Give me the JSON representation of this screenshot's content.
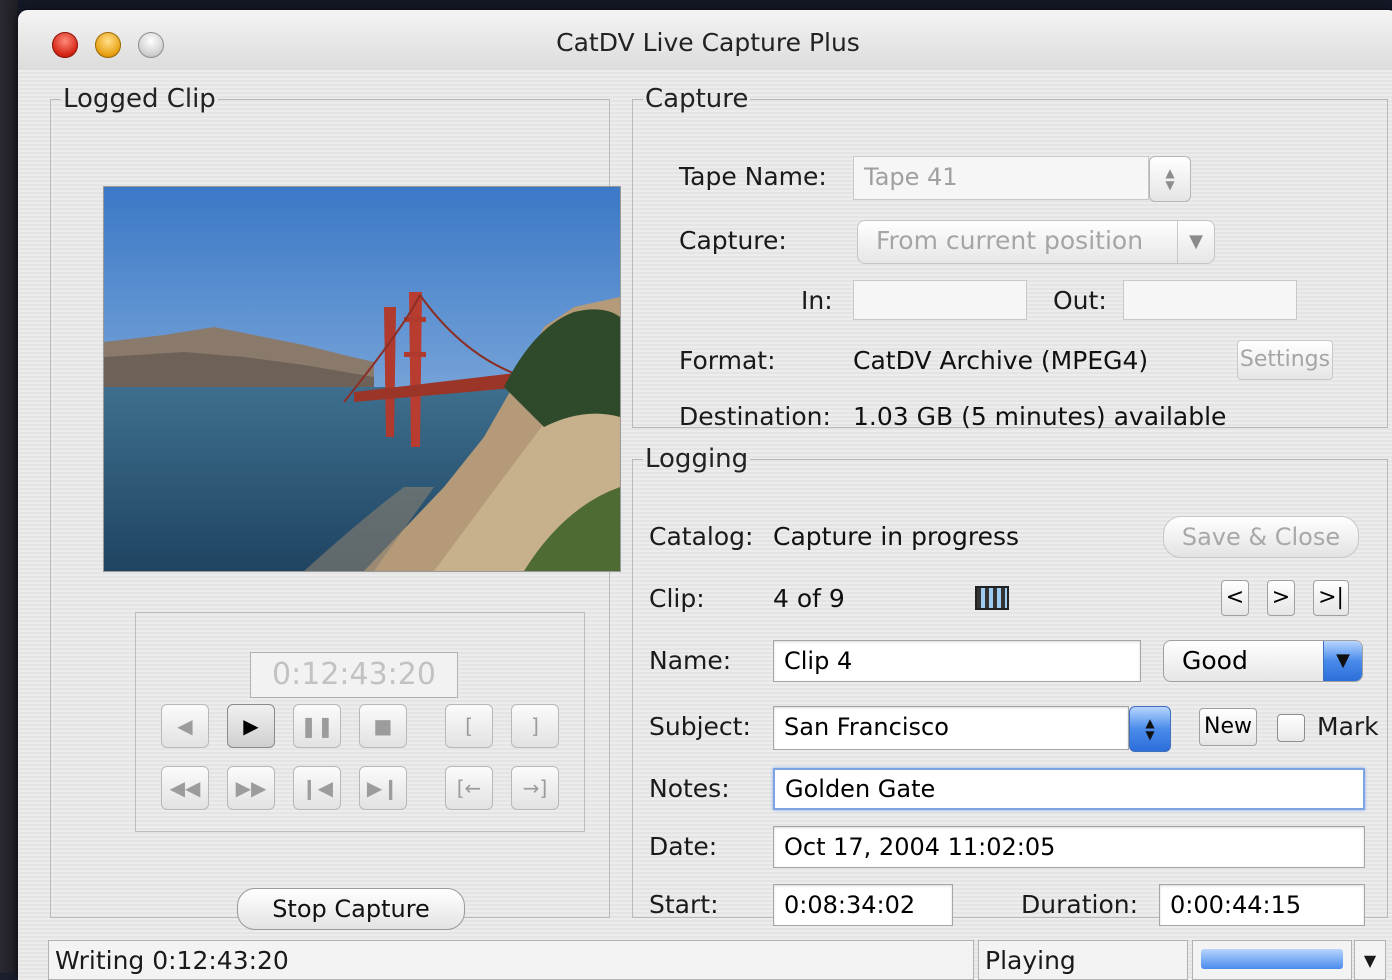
{
  "window": {
    "title": "CatDV Live Capture Plus"
  },
  "logged_clip": {
    "legend": "Logged Clip",
    "timecode": "0:12:43:20",
    "stop_capture_label": "Stop Capture"
  },
  "capture": {
    "legend": "Capture",
    "tape_name_label": "Tape Name:",
    "tape_name_value": "Tape 41",
    "capture_label": "Capture:",
    "capture_mode": "From current position",
    "in_label": "In:",
    "in_value": "",
    "out_label": "Out:",
    "out_value": "",
    "format_label": "Format:",
    "format_value": "CatDV Archive (MPEG4)",
    "settings_label": "Settings",
    "destination_label": "Destination:",
    "destination_value": "1.03 GB (5 minutes) available"
  },
  "logging": {
    "legend": "Logging",
    "catalog_label": "Catalog:",
    "catalog_value": "Capture in progress",
    "save_close_label": "Save & Close",
    "clip_label": "Clip:",
    "clip_value": "4 of 9",
    "nav_prev": "<",
    "nav_next": ">",
    "nav_last": ">|",
    "name_label": "Name:",
    "name_value": "Clip 4",
    "rating_value": "Good",
    "subject_label": "Subject:",
    "subject_value": "San Francisco",
    "new_label": "New",
    "mark_label": "Mark",
    "notes_label": "Notes:",
    "notes_value": "Golden Gate",
    "date_label": "Date:",
    "date_value": "Oct 17, 2004 11:02:05",
    "start_label": "Start:",
    "start_value": "0:08:34:02",
    "duration_label": "Duration:",
    "duration_value": "0:00:44:15"
  },
  "status": {
    "left": "Writing 0:12:43:20",
    "middle": "Playing",
    "progress": 1.0
  },
  "colors": {
    "aqua_blue": "#4a8bea",
    "focus_ring": "#7da4e0",
    "close_red": "#d42414",
    "minimize_yellow": "#e8a010"
  }
}
